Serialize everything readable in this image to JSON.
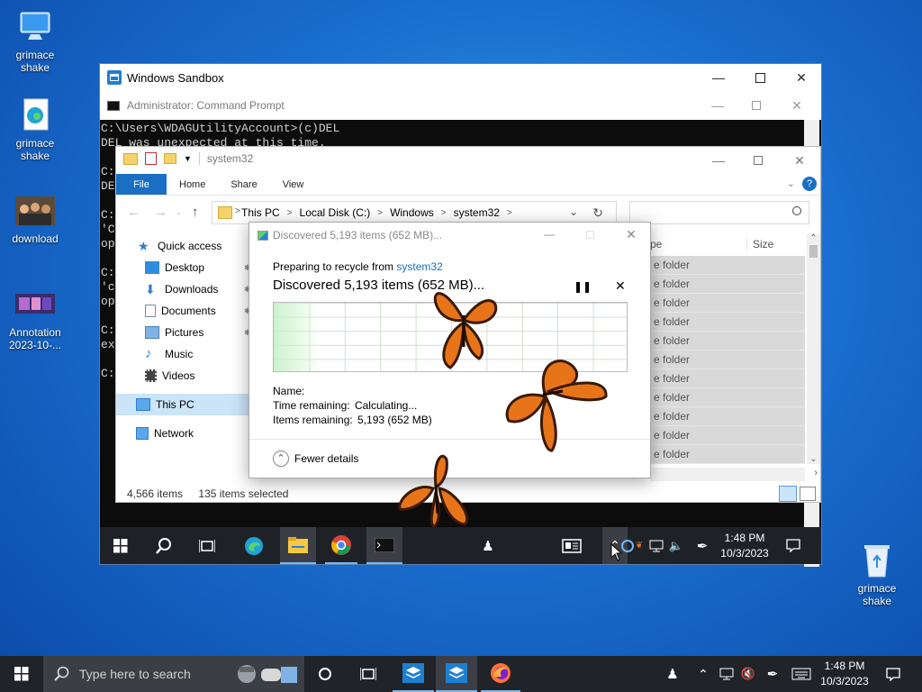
{
  "desktop": {
    "icons": [
      {
        "label": "grimace\nshake"
      },
      {
        "label": "grimace\nshake"
      },
      {
        "label": "download"
      },
      {
        "label": "Annotation\n2023-10-..."
      },
      {
        "label": "grimace\nshake"
      }
    ]
  },
  "sandbox": {
    "title": "Windows Sandbox"
  },
  "cmd": {
    "title": "Administrator: Command Prompt",
    "lines": [
      "C:\\Users\\WDAGUtilityAccount>(c)DEL",
      "DEL was unexpected at this time.",
      "",
      "C:",
      "DE",
      "",
      "C:",
      "'C",
      "op",
      "",
      "C:",
      "'c",
      "op",
      "",
      "C:",
      "ex",
      "",
      "C:"
    ]
  },
  "explorer": {
    "title": "system32",
    "tabs": [
      "File",
      "Home",
      "Share",
      "View"
    ],
    "breadcrumb": [
      "This PC",
      ">",
      "Local Disk (C:)",
      ">",
      "Windows",
      ">",
      "system32",
      ">"
    ],
    "nav": {
      "quick_access": "Quick access",
      "desktop": "Desktop",
      "downloads": "Downloads",
      "documents": "Documents",
      "pictures": "Pictures",
      "music": "Music",
      "videos": "Videos",
      "this_pc": "This PC",
      "network": "Network"
    },
    "columns": {
      "type": "pe",
      "size": "Size"
    },
    "row_label": "e folder",
    "status": {
      "items": "4,566 items",
      "selected": "135 items selected"
    }
  },
  "dialog": {
    "title": "Discovered 5,193 items (652 MB)...",
    "preparing_label": "Preparing to recycle from",
    "preparing_link": "system32",
    "headline": "Discovered 5,193 items (652 MB)...",
    "progress_fraction": 0.12,
    "name_label": "Name:",
    "time_label": "Time remaining:",
    "time_value": "Calculating...",
    "items_label": "Items remaining:",
    "items_value": "5,193 (652 MB)",
    "fewer_details": "Fewer details"
  },
  "inner_taskbar": {
    "time": "1:48 PM",
    "date": "10/3/2023"
  },
  "outer_taskbar": {
    "search_placeholder": "Type here to search",
    "time": "1:48 PM",
    "date": "10/3/2023"
  },
  "colors": {
    "accent": "#1a6fc4",
    "link": "#1a6fc4",
    "butterfly": "#e8741a"
  }
}
